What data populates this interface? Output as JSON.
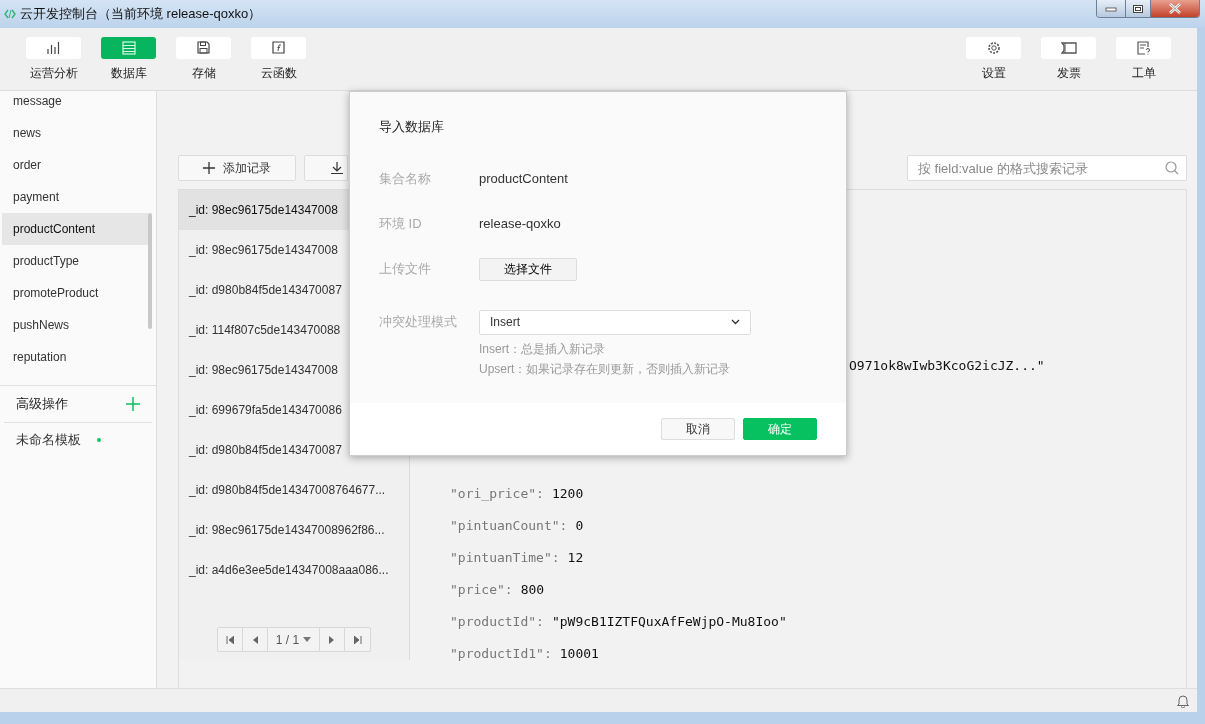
{
  "window": {
    "title": "云开发控制台（当前环境 release-qoxko）"
  },
  "toolbar": {
    "left": [
      {
        "label": "运营分析",
        "selected": false
      },
      {
        "label": "数据库",
        "selected": true
      },
      {
        "label": "存储",
        "selected": false
      },
      {
        "label": "云函数",
        "selected": false
      }
    ],
    "right": [
      {
        "label": "设置"
      },
      {
        "label": "发票"
      },
      {
        "label": "工单"
      }
    ]
  },
  "sidebar": {
    "collections": [
      {
        "label": "message",
        "selected": false
      },
      {
        "label": "news",
        "selected": false
      },
      {
        "label": "order",
        "selected": false
      },
      {
        "label": "payment",
        "selected": false
      },
      {
        "label": "productContent",
        "selected": true
      },
      {
        "label": "productType",
        "selected": false
      },
      {
        "label": "promoteProduct",
        "selected": false
      },
      {
        "label": "pushNews",
        "selected": false
      },
      {
        "label": "reputation",
        "selected": false
      }
    ],
    "advanced": {
      "label": "高级操作"
    },
    "templates": [
      {
        "label": "未命名模板",
        "color": "#07c160"
      }
    ]
  },
  "actions": {
    "add_button": "添加记录"
  },
  "search": {
    "placeholder": "按 field:value 的格式搜索记录"
  },
  "records": [
    {
      "label": "_id: 98ec96175de14347008",
      "selected": true
    },
    {
      "label": "_id: 98ec96175de14347008",
      "selected": false
    },
    {
      "label": "_id: d980b84f5de143470087",
      "selected": false
    },
    {
      "label": "_id: 114f807c5de143470088",
      "selected": false
    },
    {
      "label": "_id: 98ec96175de14347008",
      "selected": false
    },
    {
      "label": "_id: 699679fa5de143470086",
      "selected": false
    },
    {
      "label": "_id: d980b84f5de143470087",
      "selected": false
    },
    {
      "label": "_id: d980b84f5de14347008764677...",
      "selected": false
    },
    {
      "label": "_id: 98ec96175de14347008962f86...",
      "selected": false
    },
    {
      "label": "_id: a4d6e3ee5de14347008aaa086...",
      "selected": false
    }
  ],
  "pager": {
    "page": "1 / 1"
  },
  "detail": {
    "partial_value": "O971ok8wIwb3KcoG2icJZ...\"",
    "fields": [
      {
        "key": "\"ori_price\":",
        "value": "1200"
      },
      {
        "key": "\"pintuanCount\":",
        "value": "0"
      },
      {
        "key": "\"pintuanTime\":",
        "value": "12"
      },
      {
        "key": "\"price\":",
        "value": "800"
      },
      {
        "key": "\"productId\":",
        "value": "\"pW9cB1IZTFQuxAfFeWjpO-Mu8Ioo\""
      },
      {
        "key": "\"productId1\":",
        "value": "10001"
      }
    ]
  },
  "modal": {
    "title": "导入数据库",
    "rows": [
      {
        "kind": "text",
        "label": "集合名称",
        "value": "productContent"
      },
      {
        "kind": "text",
        "label": "环境 ID",
        "value": "release-qoxko"
      },
      {
        "kind": "button",
        "label": "上传文件",
        "value": "选择文件"
      },
      {
        "kind": "select",
        "label": "冲突处理模式",
        "value": "Insert"
      }
    ],
    "hints": [
      "Insert：总是插入新记录",
      "Upsert：如果记录存在则更新，否则插入新记录"
    ],
    "buttons": [
      {
        "label": "取消",
        "kind": "secondary"
      },
      {
        "label": "确定",
        "kind": "primary"
      }
    ]
  }
}
